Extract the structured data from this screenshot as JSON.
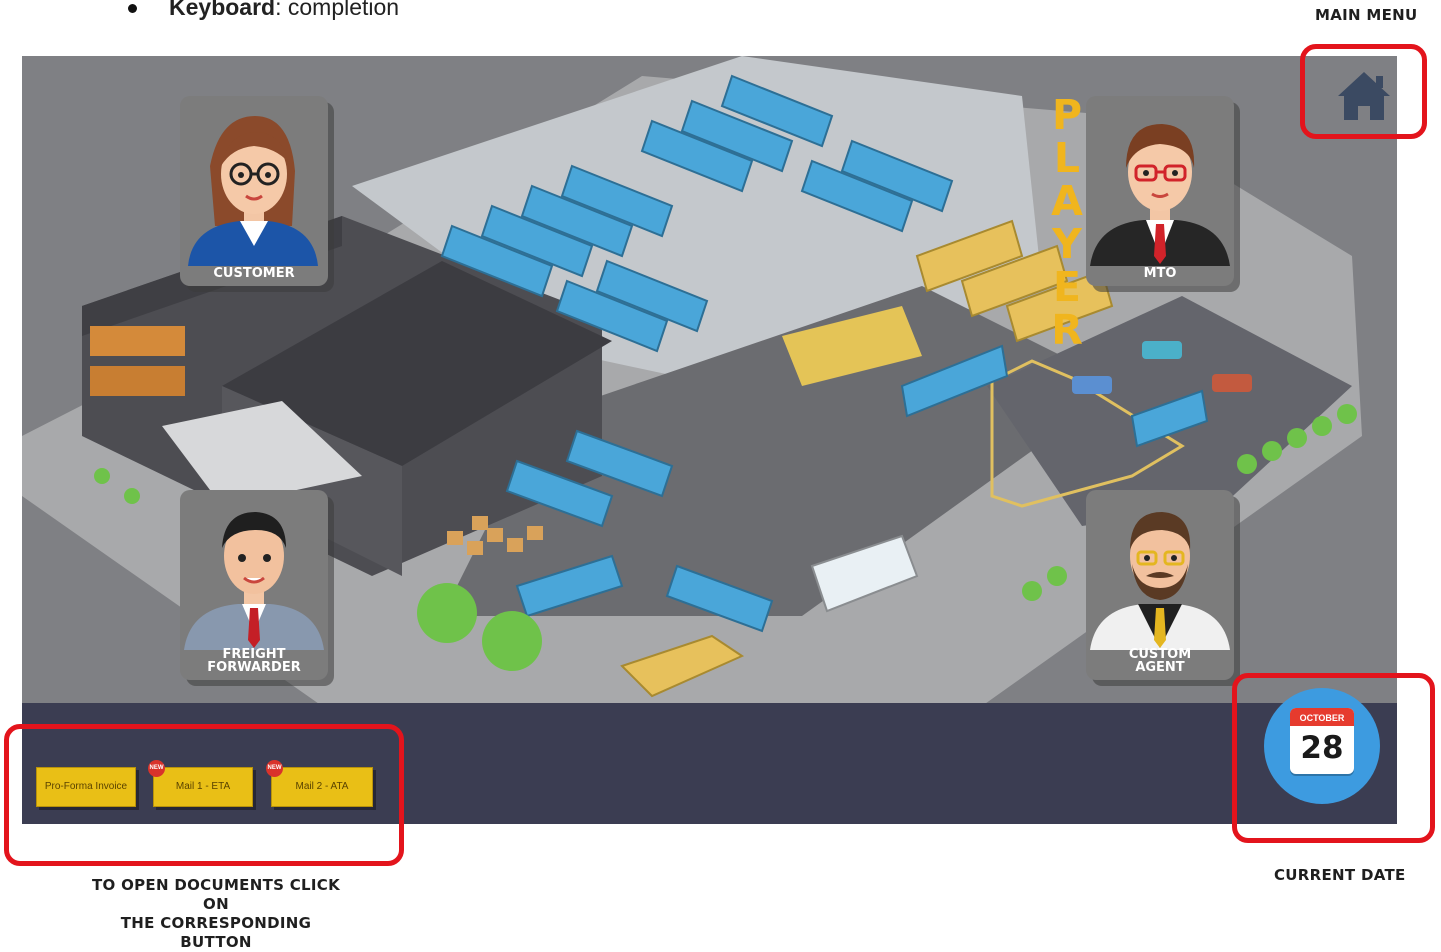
{
  "instruction": {
    "key": "Keyboard",
    "text": ": completion"
  },
  "main_menu_label": "MAIN MENU",
  "current_date_label": "CURRENT DATE",
  "documents_hint": {
    "line1": "TO OPEN DOCUMENTS CLICK ON",
    "line2": "THE CORRESPONDING BUTTON"
  },
  "player_label": [
    "P",
    "L",
    "A",
    "Y",
    "E",
    "R"
  ],
  "characters": {
    "customer": "CUSTOMER",
    "mto": "MTO",
    "freight_forwarder": {
      "line1": "FREIGHT",
      "line2": "FORWARDER"
    },
    "custom_agent": {
      "line1": "CUSTOM",
      "line2": "AGENT"
    }
  },
  "documents": [
    {
      "label": "Pro-Forma Invoice",
      "new": false
    },
    {
      "label": "Mail 1 - ETA",
      "new": true,
      "badge": "NEW"
    },
    {
      "label": "Mail 2 - ATA",
      "new": true,
      "badge": "NEW"
    }
  ],
  "calendar": {
    "month": "OCTOBER",
    "day": "28"
  },
  "icons": {
    "home": "home-icon",
    "calendar": "calendar-icon"
  },
  "colors": {
    "highlight": "#e3141c",
    "button": "#e9bf16",
    "bar": "#3b3d52",
    "player": "#f0b51e"
  }
}
